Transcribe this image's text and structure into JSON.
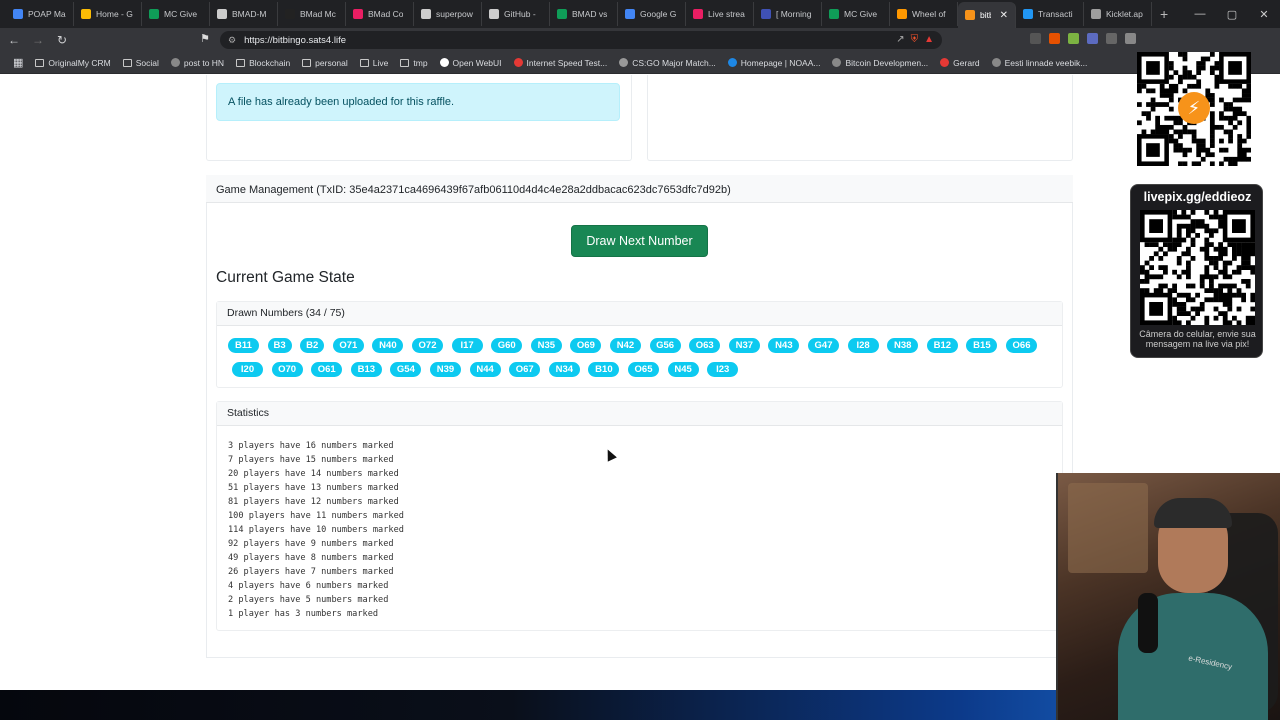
{
  "browser": {
    "tabs": [
      {
        "label": "POAP Ma",
        "color": "#4285f4"
      },
      {
        "label": "Home - G",
        "color": "#fbbc05"
      },
      {
        "label": "MC Give",
        "color": "#0f9d58"
      },
      {
        "label": "BMAD-M",
        "color": "#cccccc"
      },
      {
        "label": "BMad Mc",
        "color": "#222222"
      },
      {
        "label": "BMad Co",
        "color": "#e91e63"
      },
      {
        "label": "superpow",
        "color": "#cccccc"
      },
      {
        "label": "GitHub -",
        "color": "#cccccc"
      },
      {
        "label": "BMAD vs",
        "color": "#0f9d58"
      },
      {
        "label": "Google G",
        "color": "#4285f4"
      },
      {
        "label": "Live strea",
        "color": "#e91e63"
      },
      {
        "label": "[ Morning",
        "color": "#3f51b5"
      },
      {
        "label": "MC Give",
        "color": "#0f9d58"
      },
      {
        "label": "Wheel of",
        "color": "#ff9800"
      },
      {
        "label": "bitbi",
        "color": "#f7931a",
        "active": true
      },
      {
        "label": "Transacti",
        "color": "#2196f3"
      },
      {
        "label": "Kicklet.ap",
        "color": "#9e9e9e"
      }
    ],
    "new_tab": "+",
    "url": "https://bitbingo.sats4.life",
    "bookmarks": [
      {
        "label": "OriginalMy CRM",
        "kind": "folder"
      },
      {
        "label": "Social",
        "kind": "folder"
      },
      {
        "label": "post to HN",
        "kind": "link",
        "color": "#888888"
      },
      {
        "label": "Blockchain",
        "kind": "folder"
      },
      {
        "label": "personal",
        "kind": "folder"
      },
      {
        "label": "Live",
        "kind": "folder"
      },
      {
        "label": "tmp",
        "kind": "folder"
      },
      {
        "label": "Open WebUI",
        "kind": "link",
        "color": "#ffffff"
      },
      {
        "label": "Internet Speed Test...",
        "kind": "link",
        "color": "#e53935"
      },
      {
        "label": "CS:GO Major Match...",
        "kind": "link",
        "color": "#999999"
      },
      {
        "label": "Homepage | NOAA...",
        "kind": "link",
        "color": "#1e88e5"
      },
      {
        "label": "Bitcoin Developmen...",
        "kind": "link",
        "color": "#888888"
      },
      {
        "label": "Gerard",
        "kind": "link",
        "color": "#e53935"
      },
      {
        "label": "Eesti linnade veebik...",
        "kind": "link",
        "color": "#888888"
      }
    ],
    "bookmarks_more": "arks"
  },
  "page": {
    "alert_text": "A file has already been uploaded for this raffle.",
    "game_header": "Game Management (TxID: 35e4a2371ca4696439f67afb06110d4d4c4e28a2ddbacac623dc7653dfc7d92b)",
    "draw_button": "Draw Next Number",
    "current_state_title": "Current Game State",
    "drawn_header": "Drawn Numbers (34 / 75)",
    "drawn_numbers": [
      "B11",
      "B3",
      "B2",
      "O71",
      "N40",
      "O72",
      "I17",
      "G60",
      "N35",
      "O69",
      "N42",
      "G56",
      "O63",
      "N37",
      "N43",
      "G47",
      "I28",
      "N38",
      "B12",
      "B15",
      "O66",
      "I20",
      "O70",
      "O61",
      "B13",
      "G54",
      "N39",
      "N44",
      "O67",
      "N34",
      "B10",
      "O65",
      "N45",
      "I23"
    ],
    "ball_color": "#0dcaf0",
    "button_color": "#198754",
    "statistics_header": "Statistics",
    "statistics_lines": [
      "3 players have 16 numbers marked",
      "7 players have 15 numbers marked",
      "20 players have 14 numbers marked",
      "51 players have 13 numbers marked",
      "81 players have 12 numbers marked",
      "100 players have 11 numbers marked",
      "114 players have 10 numbers marked",
      "92 players have 9 numbers marked",
      "49 players have 8 numbers marked",
      "26 players have 7 numbers marked",
      "4 players have 6 numbers marked",
      "2 players have 5 numbers marked",
      "1 player has 3 numbers marked"
    ]
  },
  "overlay": {
    "livepix_title": "livepix.gg/eddieoz",
    "livepix_message": "Câmera do celular, envie sua mensagem na live via pix!",
    "webcam_shirt_text": "e-Residency"
  }
}
